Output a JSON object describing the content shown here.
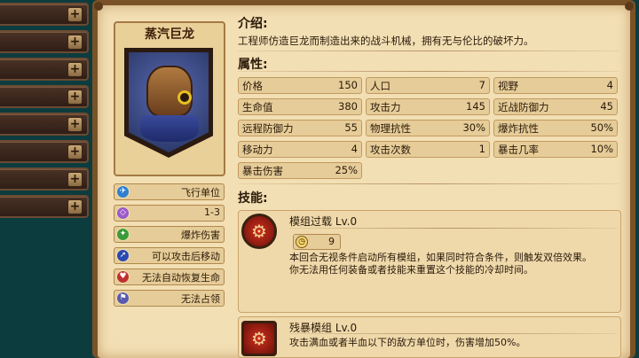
{
  "left_list": {
    "count": 8,
    "plus_label": "+"
  },
  "hero": {
    "name": "蒸汽巨龙"
  },
  "traits": [
    {
      "icon": "flying-unit-icon",
      "color": "#2f7fd0",
      "label": "飞行单位"
    },
    {
      "icon": "range-icon",
      "color": "#9a5ac8",
      "label": "1-3"
    },
    {
      "icon": "explosion-icon",
      "color": "#3a9a3a",
      "label": "爆炸伤害"
    },
    {
      "icon": "move-after-attack-icon",
      "color": "#2a4ab0",
      "label": "可以攻击后移动"
    },
    {
      "icon": "no-regen-icon",
      "color": "#c03030",
      "label": "无法自动恢复生命"
    },
    {
      "icon": "no-capture-icon",
      "color": "#5a5ab0",
      "label": "无法占领"
    }
  ],
  "intro": {
    "title": "介绍:",
    "text": "工程师仿造巨龙而制造出来的战斗机械，拥有无与伦比的破坏力。"
  },
  "attributes": {
    "title": "属性:",
    "rows": [
      [
        {
          "label": "价格",
          "value": "150"
        },
        {
          "label": "人口",
          "value": "7"
        },
        {
          "label": "视野",
          "value": "4"
        }
      ],
      [
        {
          "label": "生命值",
          "value": "380"
        },
        {
          "label": "攻击力",
          "value": "145"
        },
        {
          "label": "近战防御力",
          "value": "45"
        }
      ],
      [
        {
          "label": "远程防御力",
          "value": "55"
        },
        {
          "label": "物理抗性",
          "value": "30%"
        },
        {
          "label": "爆炸抗性",
          "value": "50%"
        }
      ],
      [
        {
          "label": "移动力",
          "value": "4"
        },
        {
          "label": "攻击次数",
          "value": "1"
        },
        {
          "label": "暴击几率",
          "value": "10%"
        }
      ],
      [
        {
          "label": "暴击伤害",
          "value": "25%"
        }
      ]
    ]
  },
  "skills": {
    "title": "技能:",
    "items": [
      {
        "name": "模组过载 Lv.0",
        "cooldown": "9",
        "desc_1": "本回合无视条件启动所有模组，如果同时符合条件，则触发双倍效果。",
        "desc_2": "你无法用任何装备或者技能来重置这个技能的冷却时间。"
      },
      {
        "name": "残暴模组 Lv.0",
        "desc_1": "攻击满血或者半血以下的敌方单位时，伤害增加50%。"
      }
    ]
  }
}
